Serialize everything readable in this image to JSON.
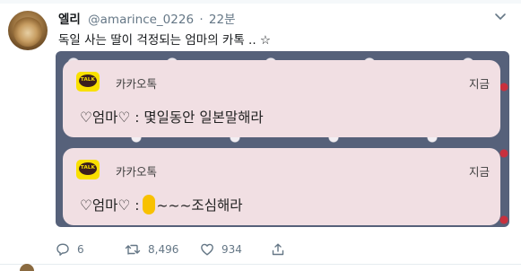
{
  "tweet": {
    "display_name": "엘리",
    "handle": "@amarince_0226",
    "time": "22분",
    "text": "독일 사는 딸이 걱정되는 엄마의 카톡 .. ☆"
  },
  "notifications": [
    {
      "app_name": "카카오톡",
      "time": "지금",
      "message": "♡엄마♡ : 몇일동안 일본말해라"
    },
    {
      "app_name": "카카오톡",
      "time": "지금",
      "message_prefix": "♡엄마♡ :",
      "message_suffix": "~~~조심해라"
    }
  ],
  "talk_logo_text": "TALK",
  "actions": {
    "reply_count": "6",
    "retweet_count": "8,496",
    "like_count": "934"
  },
  "colors": {
    "kakao_yellow": "#f9e000",
    "card_background": "#f1dfe3",
    "meta_gray": "#657786"
  },
  "icons": [
    "avatar-image",
    "chevron-down-icon",
    "kakaotalk-logo-icon",
    "reply-icon",
    "retweet-icon",
    "like-icon",
    "share-icon"
  ]
}
